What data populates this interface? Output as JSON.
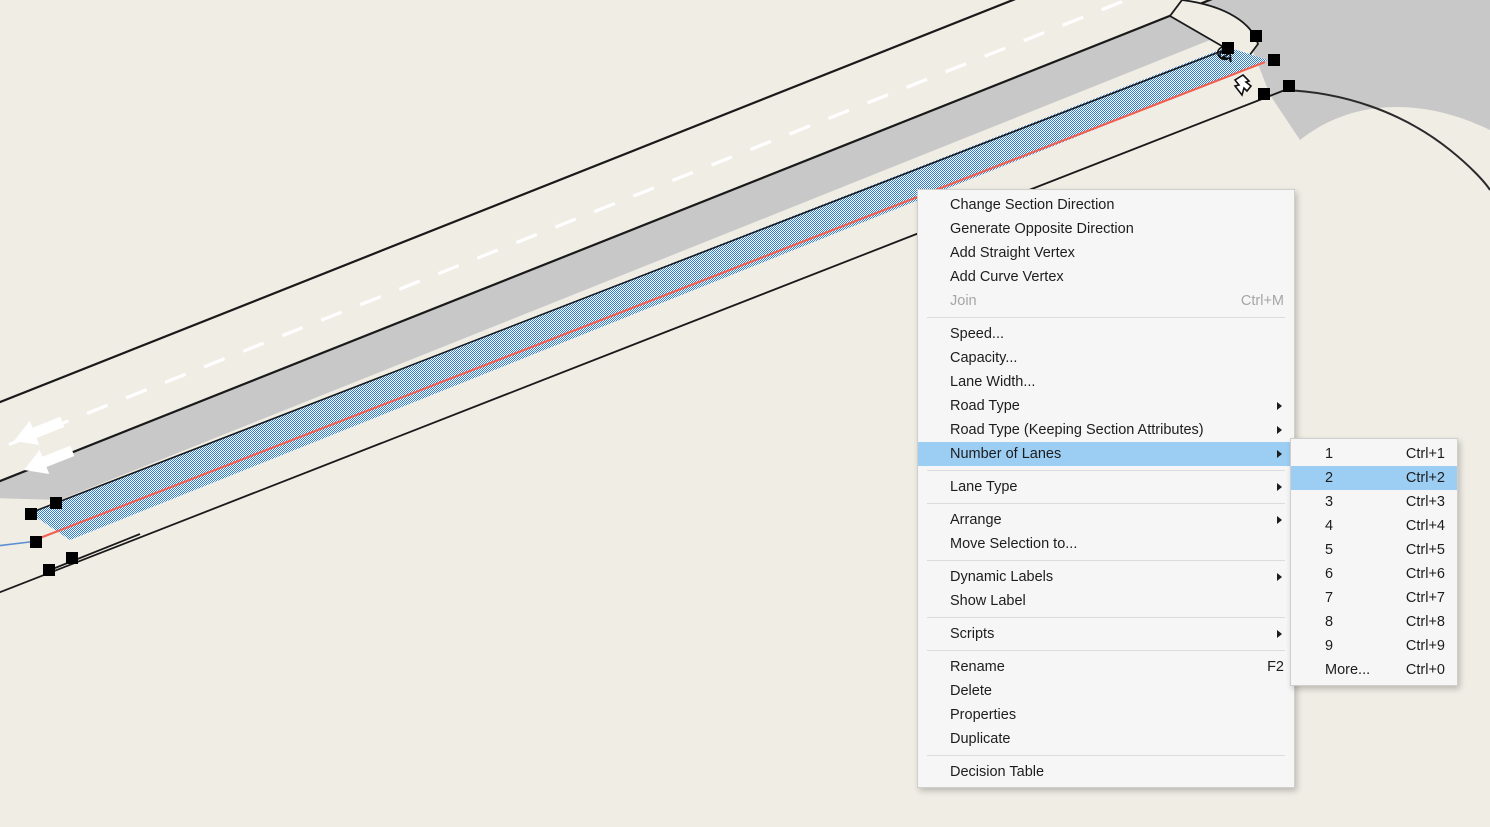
{
  "canvas": {
    "background_color": "#F0EDE5",
    "road_color": "#C8C8C8",
    "road_outline_color": "#1A1A1A",
    "selection_fill_color": "#2E7FD4",
    "selection_edge_color": "#F4604F",
    "handle_color": "#000000",
    "lane_marking_color": "#FFFFFF",
    "connector_color": "#5B8FD4",
    "arrow_direction": "left",
    "elements": {
      "main_road_label": "two-lane-road",
      "selected_section_label": "selected-road-section",
      "vertex_handle_label": "vertex-handle",
      "direction_arrow_label": "lane-direction-arrow",
      "centerline_label": "dashed-centerline",
      "turn_cursor_label": "rotate-cursor"
    }
  },
  "context_menu": {
    "name": "section-context-menu",
    "groups": [
      {
        "items": [
          {
            "label": "Change Section Direction",
            "accel": "",
            "submenu": false,
            "disabled": false,
            "highlight": false,
            "name": "change-section-direction"
          },
          {
            "label": "Generate Opposite Direction",
            "accel": "",
            "submenu": false,
            "disabled": false,
            "highlight": false,
            "name": "generate-opposite-direction"
          },
          {
            "label": "Add Straight Vertex",
            "accel": "",
            "submenu": false,
            "disabled": false,
            "highlight": false,
            "name": "add-straight-vertex"
          },
          {
            "label": "Add Curve Vertex",
            "accel": "",
            "submenu": false,
            "disabled": false,
            "highlight": false,
            "name": "add-curve-vertex"
          },
          {
            "label": "Join",
            "accel": "Ctrl+M",
            "submenu": false,
            "disabled": true,
            "highlight": false,
            "name": "join"
          }
        ]
      },
      {
        "items": [
          {
            "label": "Speed...",
            "accel": "",
            "submenu": false,
            "disabled": false,
            "highlight": false,
            "name": "speed"
          },
          {
            "label": "Capacity...",
            "accel": "",
            "submenu": false,
            "disabled": false,
            "highlight": false,
            "name": "capacity"
          },
          {
            "label": "Lane Width...",
            "accel": "",
            "submenu": false,
            "disabled": false,
            "highlight": false,
            "name": "lane-width"
          },
          {
            "label": "Road Type",
            "accel": "",
            "submenu": true,
            "disabled": false,
            "highlight": false,
            "name": "road-type"
          },
          {
            "label": "Road Type (Keeping Section Attributes)",
            "accel": "",
            "submenu": true,
            "disabled": false,
            "highlight": false,
            "name": "road-type-keeping-section-attributes"
          },
          {
            "label": "Number of Lanes",
            "accel": "",
            "submenu": true,
            "disabled": false,
            "highlight": true,
            "name": "number-of-lanes"
          }
        ]
      },
      {
        "items": [
          {
            "label": "Lane Type",
            "accel": "",
            "submenu": true,
            "disabled": false,
            "highlight": false,
            "name": "lane-type"
          }
        ]
      },
      {
        "items": [
          {
            "label": "Arrange",
            "accel": "",
            "submenu": true,
            "disabled": false,
            "highlight": false,
            "name": "arrange"
          },
          {
            "label": "Move Selection to...",
            "accel": "",
            "submenu": false,
            "disabled": false,
            "highlight": false,
            "name": "move-selection-to"
          }
        ]
      },
      {
        "items": [
          {
            "label": "Dynamic Labels",
            "accel": "",
            "submenu": true,
            "disabled": false,
            "highlight": false,
            "name": "dynamic-labels"
          },
          {
            "label": "Show Label",
            "accel": "",
            "submenu": false,
            "disabled": false,
            "highlight": false,
            "name": "show-label"
          }
        ]
      },
      {
        "items": [
          {
            "label": "Scripts",
            "accel": "",
            "submenu": true,
            "disabled": false,
            "highlight": false,
            "name": "scripts"
          }
        ]
      },
      {
        "items": [
          {
            "label": "Rename",
            "accel": "F2",
            "submenu": false,
            "disabled": false,
            "highlight": false,
            "name": "rename"
          },
          {
            "label": "Delete",
            "accel": "",
            "submenu": false,
            "disabled": false,
            "highlight": false,
            "name": "delete"
          },
          {
            "label": "Properties",
            "accel": "",
            "submenu": false,
            "disabled": false,
            "highlight": false,
            "name": "properties"
          },
          {
            "label": "Duplicate",
            "accel": "",
            "submenu": false,
            "disabled": false,
            "highlight": false,
            "name": "duplicate"
          }
        ]
      },
      {
        "items": [
          {
            "label": "Decision Table",
            "accel": "",
            "submenu": false,
            "disabled": false,
            "highlight": false,
            "name": "decision-table"
          }
        ]
      }
    ]
  },
  "lanes_submenu": {
    "name": "number-of-lanes-submenu",
    "selected_value": "2",
    "highlight_color": "#9CCEF4",
    "items": [
      {
        "label": "1",
        "accel": "Ctrl+1",
        "highlight": false,
        "name": "lanes-1"
      },
      {
        "label": "2",
        "accel": "Ctrl+2",
        "highlight": true,
        "name": "lanes-2"
      },
      {
        "label": "3",
        "accel": "Ctrl+3",
        "highlight": false,
        "name": "lanes-3"
      },
      {
        "label": "4",
        "accel": "Ctrl+4",
        "highlight": false,
        "name": "lanes-4"
      },
      {
        "label": "5",
        "accel": "Ctrl+5",
        "highlight": false,
        "name": "lanes-5"
      },
      {
        "label": "6",
        "accel": "Ctrl+6",
        "highlight": false,
        "name": "lanes-6"
      },
      {
        "label": "7",
        "accel": "Ctrl+7",
        "highlight": false,
        "name": "lanes-7"
      },
      {
        "label": "8",
        "accel": "Ctrl+8",
        "highlight": false,
        "name": "lanes-8"
      },
      {
        "label": "9",
        "accel": "Ctrl+9",
        "highlight": false,
        "name": "lanes-9"
      },
      {
        "label": "More...",
        "accel": "Ctrl+0",
        "highlight": false,
        "name": "lanes-more"
      }
    ]
  }
}
